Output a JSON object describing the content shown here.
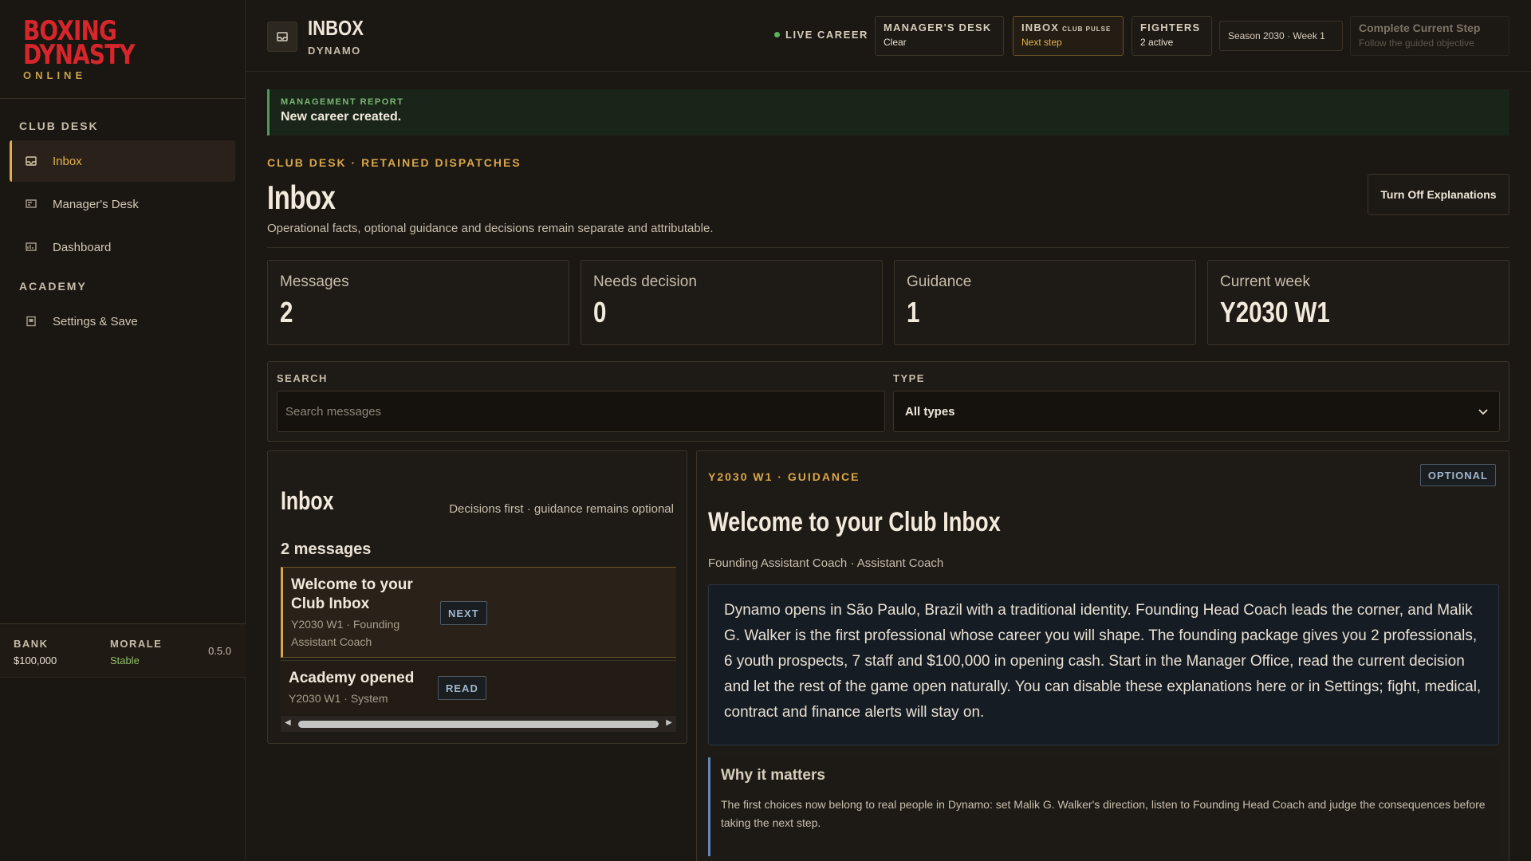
{
  "brand": {
    "line1": "Boxing",
    "line2": "Dynasty",
    "line3": "Online"
  },
  "sidebar": {
    "sections": [
      {
        "title": "Club Desk"
      },
      {
        "title": "Academy"
      }
    ],
    "items": [
      {
        "label": "Inbox",
        "icon": "inbox-icon",
        "active": true
      },
      {
        "label": "Manager's Desk",
        "icon": "desk-icon"
      },
      {
        "label": "Dashboard",
        "icon": "dashboard-icon"
      },
      {
        "label": "Settings & Save",
        "icon": "settings-icon"
      }
    ],
    "footer": {
      "bank_label": "Bank",
      "bank_value": "$100,000",
      "morale_label": "Morale",
      "morale_value": "Stable",
      "version": "0.5.0"
    }
  },
  "topbar": {
    "title": "Inbox",
    "subtitle": "Dynamo",
    "live_label": "Live Career",
    "chips": {
      "managers_desk": {
        "title": "Manager's Desk",
        "value": "Clear"
      },
      "inbox": {
        "title": "Inbox",
        "small": "Club pulse",
        "value": "Next step"
      },
      "fighters": {
        "title": "Fighters",
        "value": "2 active"
      },
      "season": "Season 2030 · Week 1",
      "step": {
        "title": "Complete Current Step",
        "value": "Follow the guided objective"
      }
    }
  },
  "banner": {
    "label": "Management Report",
    "text": "New career created."
  },
  "page": {
    "eyebrow": "Club Desk · Retained Dispatches",
    "title": "Inbox",
    "description": "Operational facts, optional guidance and decisions remain separate and attributable.",
    "explain_button": "Turn Off Explanations"
  },
  "stats": [
    {
      "label": "Messages",
      "value": "2"
    },
    {
      "label": "Needs decision",
      "value": "0"
    },
    {
      "label": "Guidance",
      "value": "1"
    },
    {
      "label": "Current week",
      "value": "Y2030 W1"
    }
  ],
  "filters": {
    "search_label": "Search",
    "search_placeholder": "Search messages",
    "search_value": "",
    "type_label": "Type",
    "type_value": "All types"
  },
  "list": {
    "title": "Inbox",
    "hint": "Decisions first · guidance remains optional",
    "count": "2 messages",
    "messages": [
      {
        "title": "Welcome to your Club Inbox",
        "meta": "Y2030 W1 · Founding Assistant Coach",
        "tag": "Next",
        "selected": true
      },
      {
        "title": "Academy opened",
        "meta": "Y2030 W1 · System",
        "tag": "Read"
      }
    ]
  },
  "detail": {
    "eyebrow": "Y2030 W1 · Guidance",
    "tag": "Optional",
    "title": "Welcome to your Club Inbox",
    "author": "Founding Assistant Coach · Assistant Coach",
    "body": "Dynamo opens in São Paulo, Brazil with a traditional identity. Founding Head Coach leads the corner, and Malik G. Walker is the first professional whose career you will shape. The founding package gives you 2 professionals, 6 youth prospects, 7 staff and $100,000 in opening cash. Start in the Manager Office, read the current decision and let the rest of the game open naturally. You can disable these explanations here or in Settings; fight, medical, contract and finance alerts will stay on.",
    "why_title": "Why it matters",
    "why_text": "The first choices now belong to real people in Dynamo: set Malik G. Walker's direction, listen to Founding Head Coach and judge the consequences before taking the next step."
  },
  "colors": {
    "accent": "#e0ae48",
    "brand_red": "#d7262b",
    "ok_green": "#58b35a",
    "info_blue": "#9fb6cc"
  }
}
